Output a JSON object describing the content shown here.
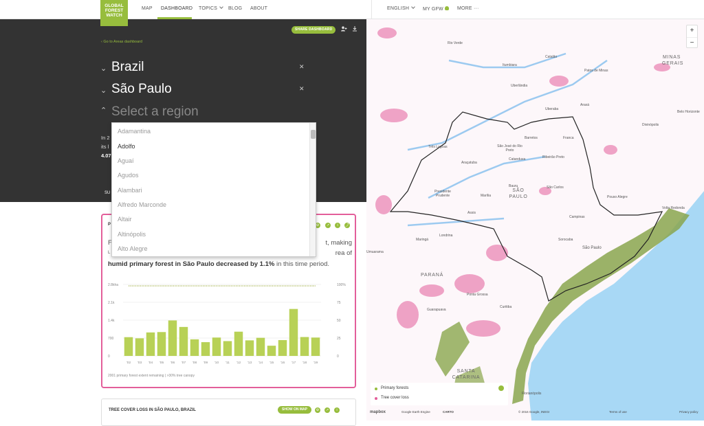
{
  "nav": {
    "logo_lines": [
      "GLOBAL",
      "FOREST",
      "WATCH"
    ],
    "links": [
      "MAP",
      "DASHBOARD",
      "TOPICS",
      "BLOG",
      "ABOUT"
    ],
    "language": "ENGLISH",
    "my_gfw": "MY GFW",
    "more": "MORE",
    "more_icon": "···"
  },
  "panel": {
    "share_label": "SHARE DASHBOARD",
    "back_label": "Go to Areas dashboard",
    "country": "Brazil",
    "state": "São Paulo",
    "region_placeholder": "Select a region",
    "summary_partial": [
      "In 2",
      "its l",
      "4.07"
    ],
    "tab_partial": "SU"
  },
  "dropdown": {
    "options": [
      "Adamantina",
      "Adolfo",
      "Aguaí",
      "Agudos",
      "Alambari",
      "Alfredo Marconde",
      "Altair",
      "Altinópolis",
      "Alto Alegre"
    ],
    "highlighted_index": 1
  },
  "widget": {
    "title_partial": "P",
    "text_left_partial": [
      "F",
      "L"
    ],
    "text_right_partial": "t, making",
    "text_right_partial2": "rea of",
    "text_bold": "humid primary forest in São Paulo decreased by 1.1%",
    "text_tail": " in this time period.",
    "note": "2001 primary forest extent remaining | >30% tree canopy"
  },
  "widget2": {
    "title": "TREE COVER LOSS IN SÃO PAULO, BRAZIL",
    "show_map": "SHOW ON MAP"
  },
  "chart_data": {
    "type": "bar",
    "categories": [
      "'02",
      "'03",
      "'04",
      "'05",
      "'06",
      "'07",
      "'08",
      "'09",
      "'10",
      "'11",
      "'12",
      "'13",
      "'14",
      "'15",
      "'16",
      "'17",
      "'18",
      "'19"
    ],
    "values": [
      735,
      690,
      920,
      935,
      1390,
      1135,
      650,
      540,
      720,
      580,
      950,
      610,
      710,
      400,
      620,
      1840,
      740,
      720
    ],
    "series_line_pct": [
      98,
      98,
      98,
      98,
      98,
      98,
      98,
      98,
      98,
      98,
      98,
      98,
      98,
      98,
      98,
      98,
      98,
      98
    ],
    "left_ticks": [
      "0",
      "700",
      "1.4k",
      "2.1k",
      "2.8kha"
    ],
    "right_ticks": [
      "0",
      "25",
      "50",
      "75",
      "100%"
    ],
    "ylim": [
      0,
      2800
    ],
    "colors": {
      "bar": "#b8d156",
      "line": "#9cab3b"
    }
  },
  "map": {
    "labels": [
      {
        "t": "Rio Verde",
        "k": "city"
      },
      {
        "t": "Catalão",
        "k": "city"
      },
      {
        "t": "MINAS",
        "k": "big"
      },
      {
        "t": "GERAIS",
        "k": "big"
      },
      {
        "t": "Itumbiara",
        "k": "city"
      },
      {
        "t": "Patos de Minas",
        "k": "city"
      },
      {
        "t": "Uberlândia",
        "k": "city"
      },
      {
        "t": "Uberaba",
        "k": "city"
      },
      {
        "t": "Araxá",
        "k": "city"
      },
      {
        "t": "Belo Horizonte",
        "k": "city"
      },
      {
        "t": "Divinópolis",
        "k": "city"
      },
      {
        "t": "Três Lagoas",
        "k": "city"
      },
      {
        "t": "Barretos",
        "k": "city"
      },
      {
        "t": "São José do Rio Preto",
        "k": "city"
      },
      {
        "t": "Franca",
        "k": "city"
      },
      {
        "t": "Ribeirão Preto",
        "k": "city"
      },
      {
        "t": "Catanduva",
        "k": "city"
      },
      {
        "t": "Araçatuba",
        "k": "city"
      },
      {
        "t": "Presidente Prudente",
        "k": "city"
      },
      {
        "t": "Marília",
        "k": "city"
      },
      {
        "t": "Bauru",
        "k": "city"
      },
      {
        "t": "SÃO PAULO",
        "k": "big"
      },
      {
        "t": "São Carlos",
        "k": "city"
      },
      {
        "t": "Campinas",
        "k": "city"
      },
      {
        "t": "Assis",
        "k": "city"
      },
      {
        "t": "Pouso Alegre",
        "k": "city"
      },
      {
        "t": "Volta Redonda",
        "k": "city"
      },
      {
        "t": "Sorocaba",
        "k": "city"
      },
      {
        "t": "São Paulo",
        "k": "city"
      },
      {
        "t": "Maringá",
        "k": "city"
      },
      {
        "t": "Londrina",
        "k": "city"
      },
      {
        "t": "Umuarama",
        "k": "city"
      },
      {
        "t": "PARANÁ",
        "k": "big"
      },
      {
        "t": "Ponta Grossa",
        "k": "city"
      },
      {
        "t": "Curitiba",
        "k": "city"
      },
      {
        "t": "Guarapuava",
        "k": "city"
      },
      {
        "t": "SANTA CATARINA",
        "k": "big"
      },
      {
        "t": "Florianópolis",
        "k": "city"
      }
    ],
    "legend": [
      {
        "label": "Primary forests",
        "color": "#97bd3d"
      },
      {
        "label": "Tree cover loss",
        "color": "#e35e9a"
      }
    ],
    "zoom_in": "+",
    "zoom_out": "−",
    "attribution": [
      "mapbox",
      "Google Earth Engine",
      "CARTO",
      "© 2016 Google, INEGI",
      "Terms of use",
      "Privacy policy"
    ]
  }
}
